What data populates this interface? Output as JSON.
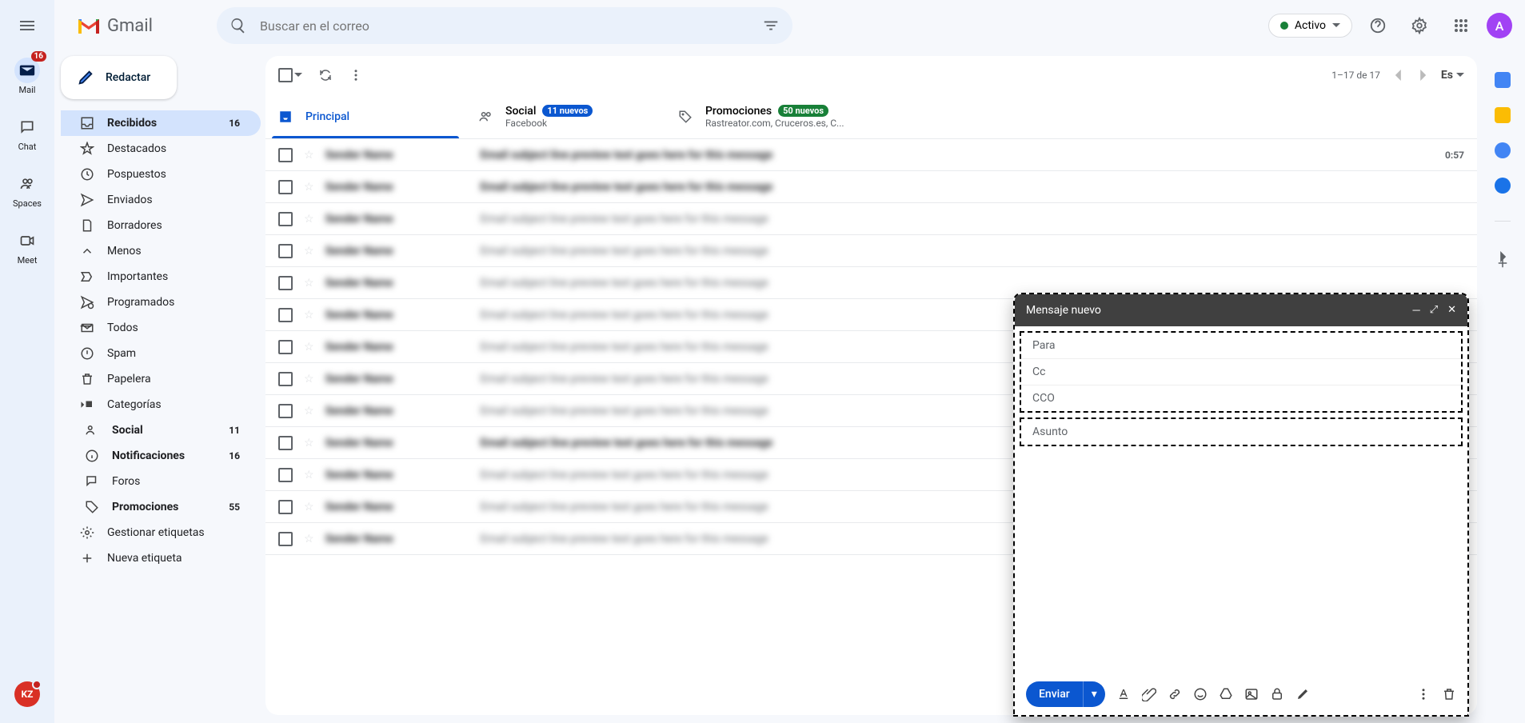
{
  "leftrail": {
    "mail": {
      "label": "Mail",
      "badge": "16"
    },
    "chat": {
      "label": "Chat"
    },
    "spaces": {
      "label": "Spaces"
    },
    "meet": {
      "label": "Meet"
    },
    "kz": "KZ"
  },
  "header": {
    "brand": "Gmail",
    "search_placeholder": "Buscar en el correo",
    "status": "Activo",
    "avatar": "A"
  },
  "compose_button": "Redactar",
  "sidebar": [
    {
      "label": "Recibidos",
      "count": "16",
      "active": true,
      "icon": "inbox"
    },
    {
      "label": "Destacados",
      "icon": "star"
    },
    {
      "label": "Pospuestos",
      "icon": "clock"
    },
    {
      "label": "Enviados",
      "icon": "send"
    },
    {
      "label": "Borradores",
      "icon": "draft"
    },
    {
      "label": "Menos",
      "icon": "collapse"
    },
    {
      "label": "Importantes",
      "icon": "important"
    },
    {
      "label": "Programados",
      "icon": "scheduled"
    },
    {
      "label": "Todos",
      "icon": "allmail"
    },
    {
      "label": "Spam",
      "icon": "spam"
    },
    {
      "label": "Papelera",
      "icon": "trash"
    },
    {
      "label": "Categorías",
      "icon": "categories"
    },
    {
      "label": "Social",
      "count": "11",
      "bold": true,
      "sub": true,
      "icon": "people"
    },
    {
      "label": "Notificaciones",
      "count": "16",
      "bold": true,
      "sub": true,
      "icon": "info"
    },
    {
      "label": "Foros",
      "sub": true,
      "icon": "forums"
    },
    {
      "label": "Promociones",
      "count": "55",
      "bold": true,
      "sub": true,
      "icon": "tag"
    },
    {
      "label": "Gestionar etiquetas",
      "icon": "settings"
    },
    {
      "label": "Nueva etiqueta",
      "icon": "plus"
    }
  ],
  "toolbar": {
    "pagination": "1–17 de 17",
    "lang": "Es"
  },
  "tabs": {
    "primary": "Principal",
    "social": {
      "title": "Social",
      "pill": "11 nuevos",
      "sub": "Facebook"
    },
    "promotions": {
      "title": "Promociones",
      "pill": "50 nuevos",
      "sub": "Rastreator.com, Cruceros.es, C..."
    }
  },
  "mailrows": [
    {
      "time": "0:57"
    },
    {},
    {},
    {},
    {},
    {},
    {},
    {},
    {},
    {},
    {},
    {},
    {}
  ],
  "compose_dialog": {
    "title": "Mensaje nuevo",
    "to": "Para",
    "cc": "Cc",
    "bcc": "CCO",
    "subject": "Asunto",
    "send": "Enviar"
  }
}
